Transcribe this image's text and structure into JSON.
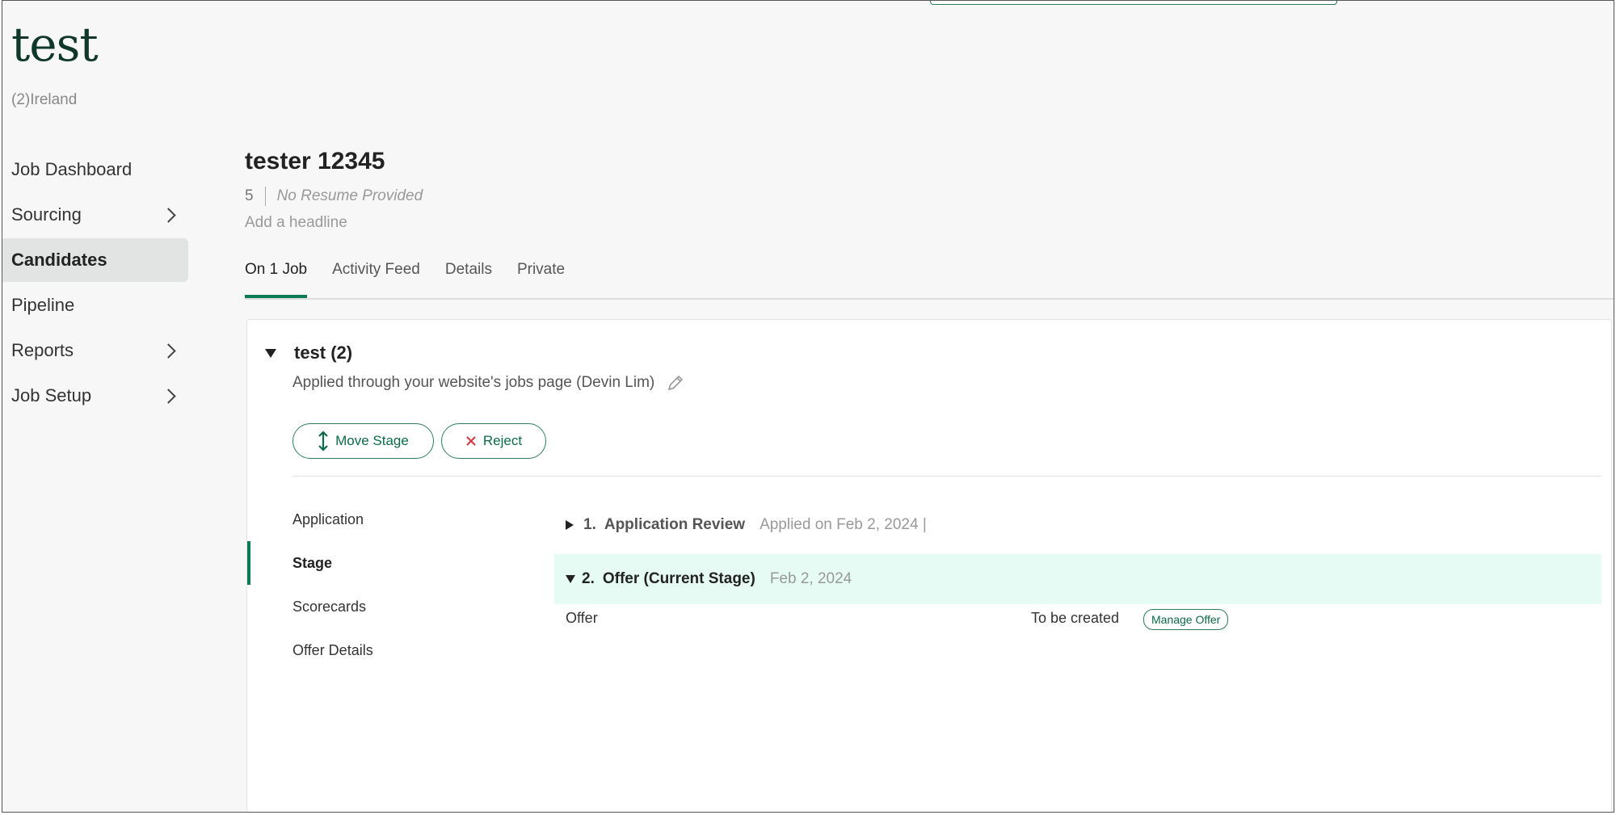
{
  "job": {
    "title": "test",
    "subtitle": "(2)Ireland"
  },
  "nav": {
    "items": [
      {
        "label": "Job Dashboard",
        "has_chevron": false,
        "active": false
      },
      {
        "label": "Sourcing",
        "has_chevron": true,
        "active": false
      },
      {
        "label": "Candidates",
        "has_chevron": false,
        "active": true
      },
      {
        "label": "Pipeline",
        "has_chevron": false,
        "active": false
      },
      {
        "label": "Reports",
        "has_chevron": true,
        "active": false
      },
      {
        "label": "Job Setup",
        "has_chevron": true,
        "active": false
      }
    ]
  },
  "candidate": {
    "name": "tester 12345",
    "count": "5",
    "resume": "No Resume Provided",
    "headline_link": "Add a headline"
  },
  "tabs": [
    {
      "label": "On 1 Job",
      "active": true
    },
    {
      "label": "Activity Feed",
      "active": false
    },
    {
      "label": "Details",
      "active": false
    },
    {
      "label": "Private",
      "active": false
    }
  ],
  "application": {
    "title": "test (2)",
    "source": "Applied through your website's jobs page (Devin Lim)",
    "move_stage_label": "Move Stage",
    "reject_label": "Reject",
    "subnav": [
      {
        "label": "Application",
        "active": false
      },
      {
        "label": "Stage",
        "active": true
      },
      {
        "label": "Scorecards",
        "active": false
      },
      {
        "label": "Offer Details",
        "active": false
      }
    ],
    "stages": [
      {
        "number": "1.",
        "name": "Application Review",
        "date": "Applied on Feb 2, 2024 |",
        "expanded": false
      },
      {
        "number": "2.",
        "name": "Offer (Current Stage)",
        "date": "Feb 2, 2024",
        "expanded": true
      }
    ],
    "offer": {
      "label": "Offer",
      "status": "To be created",
      "manage_label": "Manage Offer"
    }
  },
  "colors": {
    "accent": "#0c7a55",
    "current_stage_bg": "#e6fbf4",
    "reject_icon": "#d4343f"
  }
}
